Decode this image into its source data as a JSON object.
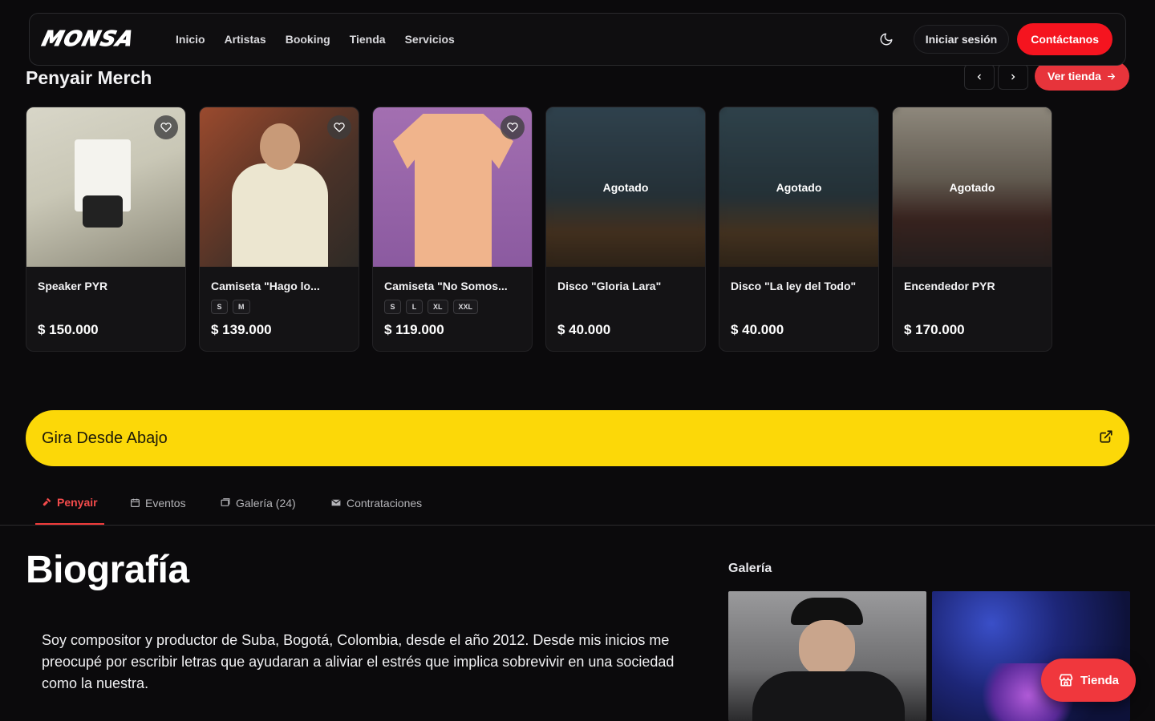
{
  "nav": {
    "logo": "MONSA",
    "links": [
      "Inicio",
      "Artistas",
      "Booking",
      "Tienda",
      "Servicios"
    ],
    "login": "Iniciar sesión",
    "contact": "Contáctanos"
  },
  "merch": {
    "title": "Penyair Merch",
    "see_store": "Ver tienda",
    "sold_out_label": "Agotado",
    "products": [
      {
        "name": "Speaker PYR",
        "sizes": [],
        "price": "$ 150.000",
        "sold_out": false
      },
      {
        "name": "Camiseta \"Hago lo...",
        "sizes": [
          "S",
          "M"
        ],
        "price": "$ 139.000",
        "sold_out": false
      },
      {
        "name": "Camiseta \"No Somos...",
        "sizes": [
          "S",
          "L",
          "XL",
          "XXL"
        ],
        "price": "$ 119.000",
        "sold_out": false
      },
      {
        "name": "Disco \"Gloria Lara\"",
        "sizes": [],
        "price": "$ 40.000",
        "sold_out": true
      },
      {
        "name": "Disco \"La ley del Todo\"",
        "sizes": [],
        "price": "$ 40.000",
        "sold_out": true
      },
      {
        "name": "Encendedor PYR",
        "sizes": [],
        "price": "$ 170.000",
        "sold_out": true
      }
    ]
  },
  "tour": {
    "label": "Gira Desde Abajo"
  },
  "tabs": [
    "Penyair",
    "Eventos",
    "Galería (24)",
    "Contrataciones"
  ],
  "bio": {
    "title": "Biografía",
    "text": "Soy compositor y productor de Suba, Bogotá, Colombia, desde el año 2012. Desde mis inicios me preocupé por escribir letras que ayudaran a aliviar el estrés que implica sobrevivir en una sociedad como la nuestra."
  },
  "gallery": {
    "title": "Galería"
  },
  "floating_shop": "Tienda",
  "colors": {
    "accent": "#f5141f",
    "tour_yellow": "#fcd808",
    "background": "#0b0a0c"
  }
}
